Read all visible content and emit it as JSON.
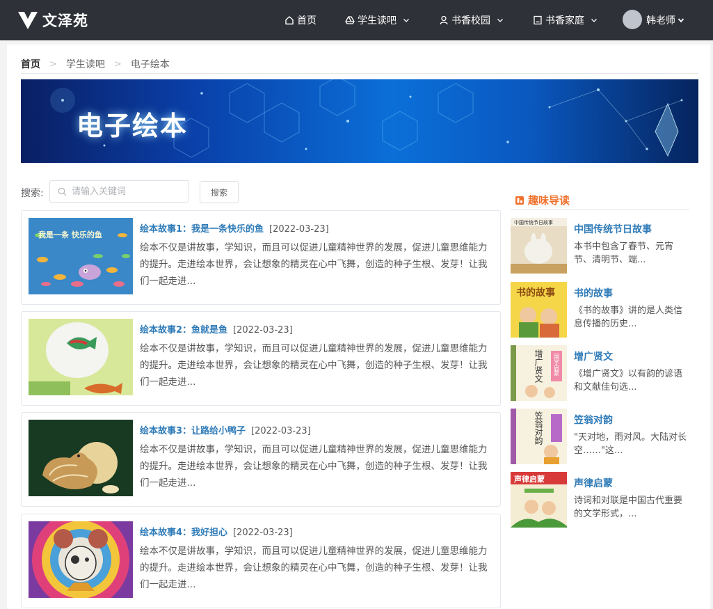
{
  "nav": {
    "logo_text": "文泽苑",
    "items": [
      {
        "label": "首页",
        "icon": "home-icon"
      },
      {
        "label": "学生读吧",
        "icon": "drive-icon"
      },
      {
        "label": "书香校园",
        "icon": "user-icon"
      },
      {
        "label": "书香家庭",
        "icon": "notebook-icon"
      }
    ],
    "user_name": "韩老师"
  },
  "breadcrumb": [
    "首页",
    "学生读吧",
    "电子绘本"
  ],
  "banner": {
    "title": "电子绘本"
  },
  "search": {
    "label": "搜索:",
    "placeholder": "请输入关键词",
    "button": "搜索"
  },
  "stories": [
    {
      "title": "绘本故事1：我是一条快乐的鱼",
      "date": "[2022-03-23]",
      "desc": " 绘本不仅是讲故事，学知识，而且可以促进儿童精神世界的发展，促进儿童思维能力的提升。走进绘本世界，会让想象的精灵在心中飞舞，创造的种子生根、发芽！让我们一起走进..."
    },
    {
      "title": "绘本故事2：鱼就是鱼",
      "date": "[2022-03-23]",
      "desc": " 绘本不仅是讲故事，学知识，而且可以促进儿童精神世界的发展，促进儿童思维能力的提升。走进绘本世界，会让想象的精灵在心中飞舞，创造的种子生根、发芽！让我们一起走进..."
    },
    {
      "title": "绘本故事3：让路给小鸭子",
      "date": "[2022-03-23]",
      "desc": " 绘本不仅是讲故事，学知识，而且可以促进儿童精神世界的发展，促进儿童思维能力的提升。走进绘本世界，会让想象的精灵在心中飞舞，创造的种子生根、发芽！让我们一起走进..."
    },
    {
      "title": "绘本故事4：我好担心",
      "date": "[2022-03-23]",
      "desc": " 绘本不仅是讲故事，学知识，而且可以促进儿童精神世界的发展，促进儿童思维能力的提升。走进绘本世界，会让想象的精灵在心中飞舞，创造的种子生根、发芽！让我们一起走进..."
    }
  ],
  "sidebar": {
    "title": "趣味导读",
    "items": [
      {
        "title": "中国传统节日故事",
        "desc": "本书中包含了春节、元宵节、清明节、端..."
      },
      {
        "title": "书的故事",
        "desc": "《书的故事》讲的是人类信息传播的历史..."
      },
      {
        "title": "增广贤文",
        "desc": "《增广贤文》以有韵的谚语和文献佳句选..."
      },
      {
        "title": "笠翁对韵",
        "desc": "\"天对地，雨对风。大陆对长空……\"这..."
      },
      {
        "title": "声律启蒙",
        "desc": "诗词和对联是中国古代重要的文学形式，..."
      }
    ]
  },
  "cover_text": {
    "story1": "我是一条 快乐的鱼",
    "side1": "中国传统节日故事",
    "side2": "书的故事",
    "side3": "增广贤文",
    "side3b": "国学启蒙",
    "side4": "笠翁对韵",
    "side5": "声律启蒙"
  },
  "colors": {
    "topbar": "#2e3137",
    "link": "#2f7bb8",
    "accent": "#f0702a"
  }
}
